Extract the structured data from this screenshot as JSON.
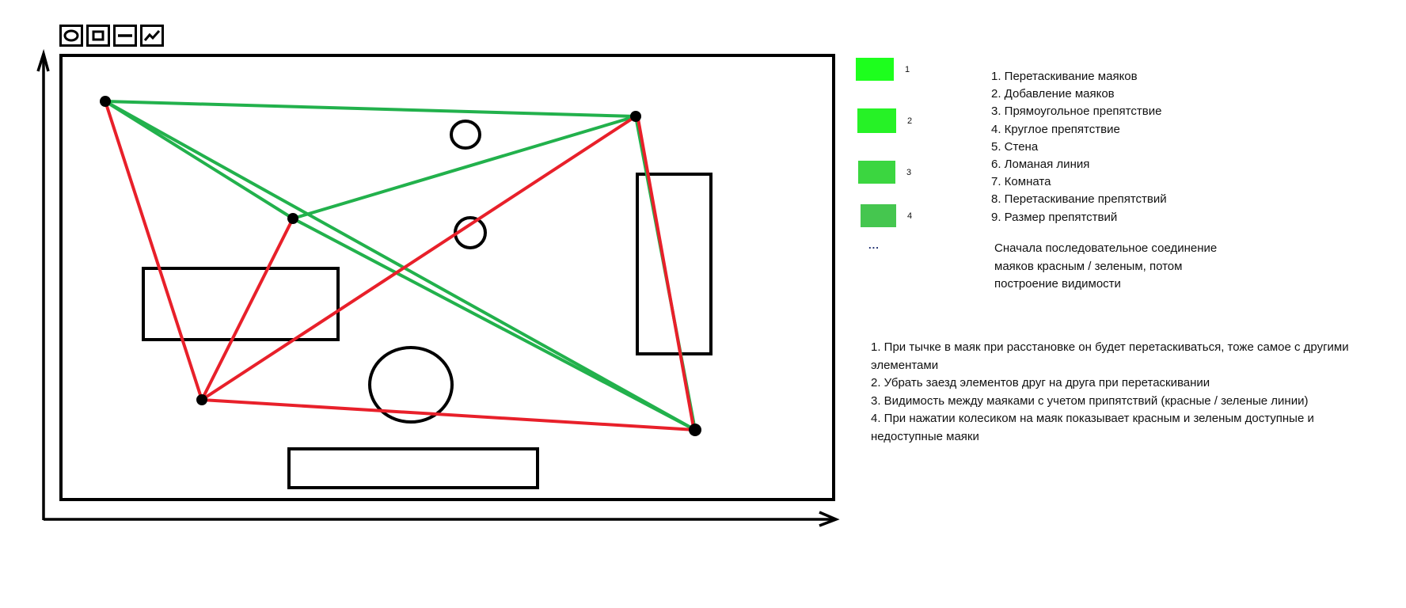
{
  "toolbar": {
    "tools": [
      {
        "icon": "circle-tool-icon"
      },
      {
        "icon": "rectangle-tool-icon"
      },
      {
        "icon": "wall-tool-icon"
      },
      {
        "icon": "polyline-tool-icon"
      }
    ]
  },
  "colors": {
    "red": "#e8202a",
    "green": "#22b14c",
    "black": "#000000"
  },
  "legend_swatches": [
    {
      "label": "1",
      "color": "#1dff1d"
    },
    {
      "label": "2",
      "color": "#26f226"
    },
    {
      "label": "3",
      "color": "#3bd640"
    },
    {
      "label": "4",
      "color": "#45c64f"
    }
  ],
  "legend_ellipsis": "...",
  "features": [
    "1. Перетаскивание маяков",
    "2. Добавление маяков",
    "3. Прямоугольное препятствие",
    "4. Круглое препятствие",
    "5. Стена",
    "6. Ломаная линия",
    "7. Комната",
    "8. Перетаскивание препятствий",
    "9. Размер препятствий"
  ],
  "note": "Сначала последовательное соединение маяков красным / зеленым, потом построение видимости",
  "tasks": [
    "1. При тычке в маяк при расстановке он будет перетаскиваться, тоже самое с другими элементами",
    "2. Убрать заезд элементов друг на друга при перетаскивании",
    "3. Видимость между маяками с учетом припятствий (красные / зеленые линии)",
    "4. При нажатии колесиком на маяк показывает красным и зеленым доступные и недоступные маяки"
  ]
}
